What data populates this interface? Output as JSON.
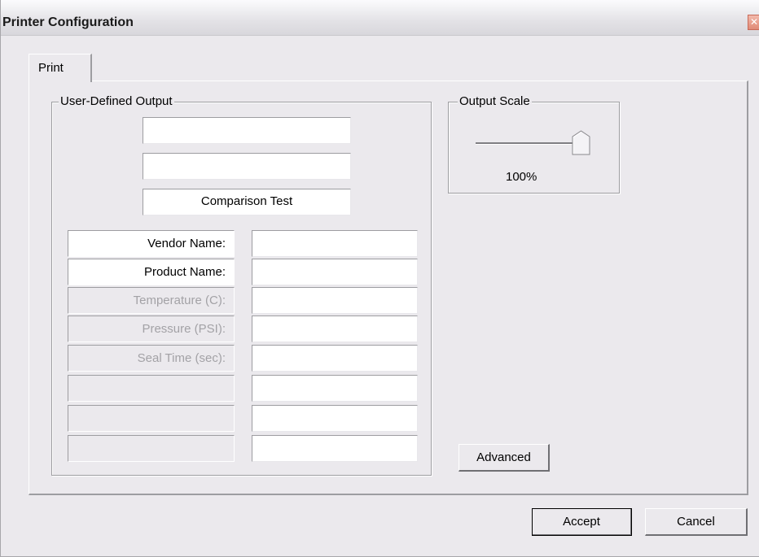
{
  "window": {
    "title": "Printer Configuration",
    "close_glyph": "✕"
  },
  "tabs": [
    {
      "label": "Print",
      "selected": true
    }
  ],
  "user_defined_output": {
    "label": "User-Defined Output",
    "header_fields": [
      {
        "value": ""
      },
      {
        "value": ""
      },
      {
        "value": "Comparison Test"
      }
    ],
    "rows": [
      {
        "label": "Vendor Name:",
        "enabled": true,
        "value": ""
      },
      {
        "label": "Product Name:",
        "enabled": true,
        "value": ""
      },
      {
        "label": "Temperature (C):",
        "enabled": false,
        "value": ""
      },
      {
        "label": "Pressure (PSI):",
        "enabled": false,
        "value": ""
      },
      {
        "label": "Seal Time (sec):",
        "enabled": false,
        "value": ""
      },
      {
        "label": "",
        "enabled": false,
        "value": ""
      },
      {
        "label": "",
        "enabled": false,
        "value": ""
      },
      {
        "label": "",
        "enabled": false,
        "value": ""
      }
    ]
  },
  "output_scale": {
    "label": "Output Scale",
    "value_text": "100%",
    "slider_value": 1.0
  },
  "buttons": {
    "advanced": "Advanced",
    "accept": "Accept",
    "cancel": "Cancel"
  },
  "icons": {
    "close": "close-icon",
    "slider_thumb": "slider-thumb-icon"
  },
  "colors": {
    "dialog_background": "#ebe9ed",
    "field_background": "#ffffff",
    "disabled_text": "#a3a2a6"
  }
}
